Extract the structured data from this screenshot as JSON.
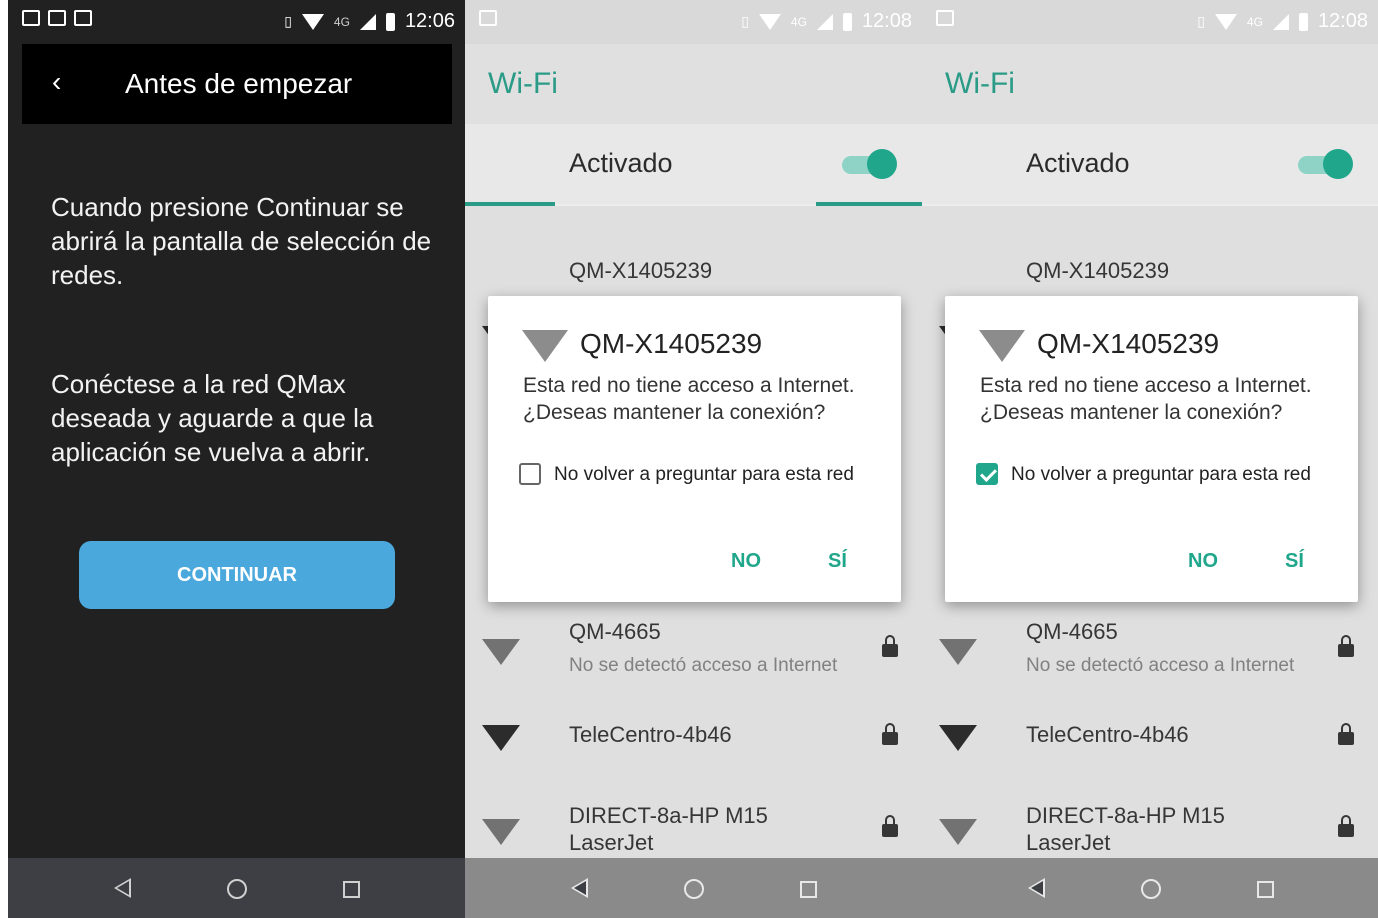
{
  "screen1": {
    "status": {
      "time": "12:06",
      "network": "4G"
    },
    "appbar": {
      "back_icon": "chevron-left-icon",
      "title": "Antes de empezar"
    },
    "paragraph1": "Cuando presione Continuar se abrirá la pantalla de selección de redes.",
    "paragraph2": "Conéctese a la red QMax deseada y aguarde a que la aplicación se vuelva a abrir.",
    "continue_label": "CONTINUAR",
    "button_color": "#4aa8dc"
  },
  "screen2": {
    "status": {
      "time": "12:08",
      "network": "4G"
    },
    "header_title": "Wi-Fi",
    "toggle_label": "Activado",
    "toggle_on": true,
    "networks": [
      {
        "name": "QM-X1405239",
        "status": "",
        "locked": true
      },
      {
        "name": "QM-4665",
        "status": "No se detectó acceso a Internet",
        "locked": true
      },
      {
        "name": "TeleCentro-4b46",
        "status": "",
        "locked": true
      },
      {
        "name": "DIRECT-8a-HP M15",
        "name2": "LaserJet",
        "status": "",
        "locked": true
      }
    ],
    "dialog": {
      "title": "QM-X1405239",
      "message": "Esta red no tiene acceso a Internet. ¿Deseas mantener la conexión?",
      "checkbox_label": "No volver a preguntar para esta red",
      "checkbox_checked": false,
      "no_label": "NO",
      "yes_label": "SÍ"
    }
  },
  "screen3": {
    "status": {
      "time": "12:08",
      "network": "4G"
    },
    "header_title": "Wi-Fi",
    "toggle_label": "Activado",
    "toggle_on": true,
    "networks": [
      {
        "name": "QM-X1405239",
        "status": "",
        "locked": true
      },
      {
        "name": "QM-4665",
        "status": "No se detectó acceso a Internet",
        "locked": true
      },
      {
        "name": "TeleCentro-4b46",
        "status": "",
        "locked": true
      },
      {
        "name": "DIRECT-8a-HP M15",
        "name2": "LaserJet",
        "status": "",
        "locked": true
      }
    ],
    "dialog": {
      "title": "QM-X1405239",
      "message": "Esta red no tiene acceso a Internet. ¿Deseas mantener la conexión?",
      "checkbox_label": "No volver a preguntar para esta red",
      "checkbox_checked": true,
      "no_label": "NO",
      "yes_label": "SÍ"
    }
  },
  "accent_color": "#1fa68b"
}
